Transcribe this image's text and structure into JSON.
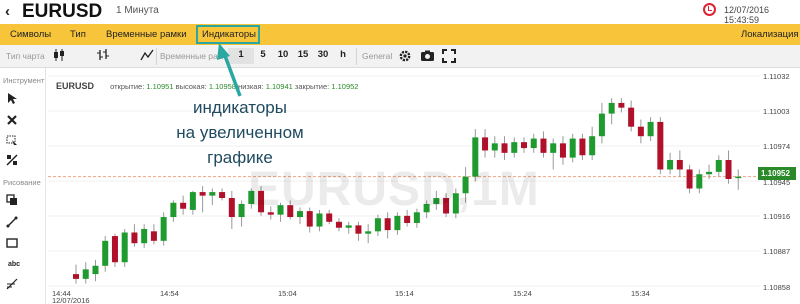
{
  "title": {
    "back_glyph": "‹",
    "symbol": "EURUSD",
    "timeframe": "1 Минута",
    "datetime": "12/07/2016 15:43:59",
    "alarm_icon": "alarm-clock-icon"
  },
  "menu": {
    "symbols": "Символы",
    "type": "Тип",
    "timeframes": "Временные рамки",
    "indicators": "Индикаторы",
    "localization": "Локализация",
    "highlight_color": "#2aa7a0",
    "bar_color": "#f7c43a"
  },
  "toolbar": {
    "chart_type_label": "Тип чарта",
    "timeframes_label": "Временные рамк",
    "tf_buttons": [
      "1",
      "5",
      "10",
      "15",
      "30",
      "h"
    ],
    "general_label": "General",
    "icons": [
      "candles-icon",
      "bars-icon",
      "line-icon",
      "settings-icon",
      "camera-icon",
      "fullscreen-icon"
    ]
  },
  "leftpanel": {
    "tools_label": "Инструмент",
    "drawing_label": "Рисование",
    "tool_icons": [
      "cursor-icon",
      "delete-icon",
      "zoom-select-icon",
      "measure-icon",
      "copy-icon",
      "line-tool-icon",
      "rectangle-icon",
      "text-tool-icon",
      "fibonacci-icon"
    ],
    "text_tool_glyph": "abc"
  },
  "ohlc": {
    "symbol": "EURUSD",
    "open_label": "открытие:",
    "open": "1.10951",
    "high_label": "высокая:",
    "high": "1.10958",
    "low_label": "низкая:",
    "low": "1.10941",
    "close_label": "закрытие:",
    "close": "1.10952"
  },
  "annotation": {
    "line1": "индикаторы",
    "line2": "на увеличенном",
    "line3": "графике",
    "color": "#1f4a5f"
  },
  "watermark": "EURUSD,1M",
  "chart_data": {
    "type": "candlestick",
    "ylim": [
      1.1086,
      1.1104
    ],
    "y_ticks": [
      "1.11032",
      "1.11003",
      "1.10974",
      "1.10945",
      "1.10916",
      "1.10887",
      "1.10858"
    ],
    "current_price": "1.10952",
    "up_color": "#1e9a2e",
    "down_color": "#b0102a",
    "x_ticks": [
      "14:44",
      "14:54",
      "15:04",
      "15:14",
      "15:24",
      "15:34"
    ],
    "start_date": "12/07/2016",
    "candles": [
      {
        "o": 1.1087,
        "h": 1.10878,
        "l": 1.10862,
        "c": 1.10866
      },
      {
        "o": 1.10866,
        "h": 1.1088,
        "l": 1.10862,
        "c": 1.10874
      },
      {
        "o": 1.1087,
        "h": 1.10882,
        "l": 1.10864,
        "c": 1.10877
      },
      {
        "o": 1.10877,
        "h": 1.10902,
        "l": 1.10872,
        "c": 1.10898
      },
      {
        "o": 1.10902,
        "h": 1.10904,
        "l": 1.10876,
        "c": 1.1088
      },
      {
        "o": 1.1088,
        "h": 1.10908,
        "l": 1.10876,
        "c": 1.10905
      },
      {
        "o": 1.10905,
        "h": 1.10912,
        "l": 1.10893,
        "c": 1.10896
      },
      {
        "o": 1.10896,
        "h": 1.10912,
        "l": 1.10892,
        "c": 1.10908
      },
      {
        "o": 1.10906,
        "h": 1.10912,
        "l": 1.10895,
        "c": 1.10898
      },
      {
        "o": 1.10898,
        "h": 1.10922,
        "l": 1.10894,
        "c": 1.10918
      },
      {
        "o": 1.10918,
        "h": 1.10932,
        "l": 1.10914,
        "c": 1.1093
      },
      {
        "o": 1.1093,
        "h": 1.10936,
        "l": 1.1092,
        "c": 1.10925
      },
      {
        "o": 1.10924,
        "h": 1.1094,
        "l": 1.1092,
        "c": 1.10939
      },
      {
        "o": 1.10939,
        "h": 1.10944,
        "l": 1.10922,
        "c": 1.10936
      },
      {
        "o": 1.10936,
        "h": 1.10942,
        "l": 1.10928,
        "c": 1.10939
      },
      {
        "o": 1.10939,
        "h": 1.10942,
        "l": 1.10932,
        "c": 1.10934
      },
      {
        "o": 1.10934,
        "h": 1.1094,
        "l": 1.10908,
        "c": 1.10918
      },
      {
        "o": 1.10918,
        "h": 1.10932,
        "l": 1.1091,
        "c": 1.10929
      },
      {
        "o": 1.10929,
        "h": 1.10942,
        "l": 1.10925,
        "c": 1.1094
      },
      {
        "o": 1.1094,
        "h": 1.10944,
        "l": 1.10919,
        "c": 1.10922
      },
      {
        "o": 1.10922,
        "h": 1.10927,
        "l": 1.10916,
        "c": 1.1092
      },
      {
        "o": 1.1092,
        "h": 1.1093,
        "l": 1.10914,
        "c": 1.10928
      },
      {
        "o": 1.10928,
        "h": 1.10932,
        "l": 1.10916,
        "c": 1.10918
      },
      {
        "o": 1.10918,
        "h": 1.10926,
        "l": 1.10912,
        "c": 1.10923
      },
      {
        "o": 1.10923,
        "h": 1.10926,
        "l": 1.10905,
        "c": 1.1091
      },
      {
        "o": 1.1091,
        "h": 1.10924,
        "l": 1.10906,
        "c": 1.10921
      },
      {
        "o": 1.10921,
        "h": 1.10924,
        "l": 1.10912,
        "c": 1.10914
      },
      {
        "o": 1.10914,
        "h": 1.10917,
        "l": 1.10906,
        "c": 1.10909
      },
      {
        "o": 1.10909,
        "h": 1.10914,
        "l": 1.10904,
        "c": 1.10911
      },
      {
        "o": 1.10911,
        "h": 1.10914,
        "l": 1.10898,
        "c": 1.10904
      },
      {
        "o": 1.10904,
        "h": 1.10912,
        "l": 1.10896,
        "c": 1.10906
      },
      {
        "o": 1.10906,
        "h": 1.1092,
        "l": 1.10902,
        "c": 1.10917
      },
      {
        "o": 1.10917,
        "h": 1.10922,
        "l": 1.109,
        "c": 1.10907
      },
      {
        "o": 1.10907,
        "h": 1.10922,
        "l": 1.10903,
        "c": 1.10919
      },
      {
        "o": 1.10919,
        "h": 1.10924,
        "l": 1.1091,
        "c": 1.10913
      },
      {
        "o": 1.10913,
        "h": 1.10925,
        "l": 1.10909,
        "c": 1.10922
      },
      {
        "o": 1.10922,
        "h": 1.10932,
        "l": 1.10917,
        "c": 1.10929
      },
      {
        "o": 1.10929,
        "h": 1.1094,
        "l": 1.10924,
        "c": 1.10934
      },
      {
        "o": 1.10934,
        "h": 1.10938,
        "l": 1.10918,
        "c": 1.10921
      },
      {
        "o": 1.10921,
        "h": 1.10942,
        "l": 1.10917,
        "c": 1.10938
      },
      {
        "o": 1.10938,
        "h": 1.1096,
        "l": 1.1093,
        "c": 1.10952
      },
      {
        "o": 1.10952,
        "h": 1.10992,
        "l": 1.10948,
        "c": 1.10985
      },
      {
        "o": 1.10985,
        "h": 1.10992,
        "l": 1.10968,
        "c": 1.10974
      },
      {
        "o": 1.10974,
        "h": 1.10986,
        "l": 1.10968,
        "c": 1.1098
      },
      {
        "o": 1.1098,
        "h": 1.10986,
        "l": 1.10966,
        "c": 1.10972
      },
      {
        "o": 1.10972,
        "h": 1.10985,
        "l": 1.10968,
        "c": 1.10981
      },
      {
        "o": 1.10981,
        "h": 1.10985,
        "l": 1.10972,
        "c": 1.10976
      },
      {
        "o": 1.10976,
        "h": 1.10988,
        "l": 1.10972,
        "c": 1.10984
      },
      {
        "o": 1.10984,
        "h": 1.1099,
        "l": 1.10968,
        "c": 1.10972
      },
      {
        "o": 1.10972,
        "h": 1.10984,
        "l": 1.10958,
        "c": 1.1098
      },
      {
        "o": 1.1098,
        "h": 1.10986,
        "l": 1.10962,
        "c": 1.10968
      },
      {
        "o": 1.10968,
        "h": 1.10988,
        "l": 1.10964,
        "c": 1.10984
      },
      {
        "o": 1.10984,
        "h": 1.10988,
        "l": 1.10966,
        "c": 1.1097
      },
      {
        "o": 1.1097,
        "h": 1.10994,
        "l": 1.10966,
        "c": 1.10986
      },
      {
        "o": 1.10986,
        "h": 1.11014,
        "l": 1.1098,
        "c": 1.11005
      },
      {
        "o": 1.11005,
        "h": 1.11018,
        "l": 1.10996,
        "c": 1.11014
      },
      {
        "o": 1.11014,
        "h": 1.11018,
        "l": 1.11006,
        "c": 1.1101
      },
      {
        "o": 1.1101,
        "h": 1.11016,
        "l": 1.1099,
        "c": 1.10994
      },
      {
        "o": 1.10994,
        "h": 1.11,
        "l": 1.1098,
        "c": 1.10986
      },
      {
        "o": 1.10986,
        "h": 1.11002,
        "l": 1.10982,
        "c": 1.10998
      },
      {
        "o": 1.10998,
        "h": 1.11002,
        "l": 1.10954,
        "c": 1.10958
      },
      {
        "o": 1.10958,
        "h": 1.10972,
        "l": 1.10954,
        "c": 1.10966
      },
      {
        "o": 1.10966,
        "h": 1.10974,
        "l": 1.10952,
        "c": 1.10958
      },
      {
        "o": 1.10958,
        "h": 1.10962,
        "l": 1.10938,
        "c": 1.10942
      },
      {
        "o": 1.10942,
        "h": 1.10958,
        "l": 1.10938,
        "c": 1.10954
      },
      {
        "o": 1.10954,
        "h": 1.10962,
        "l": 1.1095,
        "c": 1.10956
      },
      {
        "o": 1.10956,
        "h": 1.1097,
        "l": 1.10952,
        "c": 1.10966
      },
      {
        "o": 1.10966,
        "h": 1.10974,
        "l": 1.10946,
        "c": 1.1095
      },
      {
        "o": 1.10951,
        "h": 1.10958,
        "l": 1.10941,
        "c": 1.10952
      }
    ]
  }
}
